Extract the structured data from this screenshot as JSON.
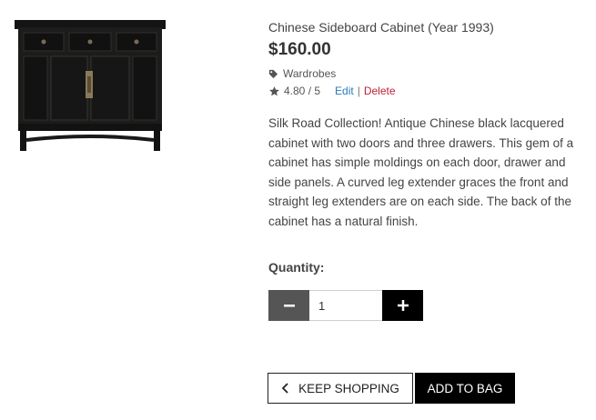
{
  "product": {
    "title": "Chinese Sideboard Cabinet (Year 1993)",
    "price": "$160.00",
    "category": "Wardrobes",
    "rating": "4.80 / 5",
    "edit_label": "Edit",
    "separator": "|",
    "delete_label": "Delete",
    "description": "Silk Road Collection! Antique Chinese black lacquered cabinet with two doors and three drawers. This gem of a cabinet has simple moldings on each door, drawer and side panels. A curved leg extender graces the front and straight leg extenders are on each side. The back of the cabinet has a natural finish.",
    "image_icon": "cabinet-image"
  },
  "quantity": {
    "label": "Quantity:",
    "value": "1",
    "minus_icon": "minus-icon",
    "plus_icon": "plus-icon"
  },
  "actions": {
    "keep_shopping": "KEEP SHOPPING",
    "add_to_bag": "ADD TO BAG"
  },
  "colors": {
    "delete": "#c0203a",
    "edit": "#2a7ac0",
    "minus_bg": "#555555",
    "plus_bg": "#000000"
  }
}
